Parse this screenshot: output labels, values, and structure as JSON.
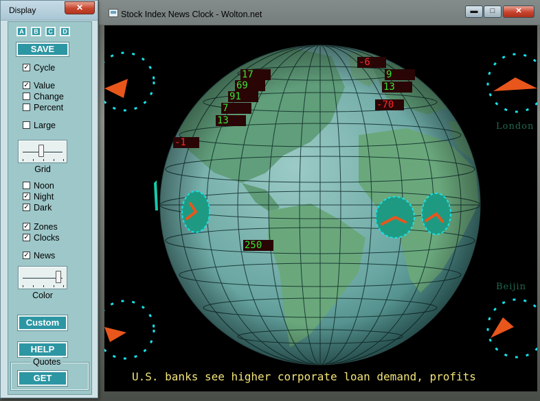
{
  "panel": {
    "title": "Display",
    "close_glyph": "✕",
    "letters": [
      "A",
      "B",
      "C",
      "D"
    ],
    "save_label": "SAVE",
    "options": [
      {
        "label": "Cycle",
        "checked": true
      },
      {
        "label": "Value",
        "checked": true
      },
      {
        "label": "Change",
        "checked": false
      },
      {
        "label": "Percent",
        "checked": false
      },
      {
        "label": "Large",
        "checked": false
      },
      {
        "label": "Noon",
        "checked": false
      },
      {
        "label": "Night",
        "checked": true
      },
      {
        "label": "Dark",
        "checked": true
      },
      {
        "label": "Zones",
        "checked": true
      },
      {
        "label": "Clocks",
        "checked": true
      },
      {
        "label": "News",
        "checked": true
      }
    ],
    "grid_label": "Grid",
    "grid_level": 0.45,
    "color_label": "Color",
    "color_level": 0.95,
    "custom_label": "Custom",
    "help_label": "HELP",
    "quotes_label": "Quotes",
    "get_label": "GET",
    "check_glyph": "✓"
  },
  "window": {
    "title": "Stock Index News Clock  -  Wolton.net",
    "minimize_glyph": "▬",
    "maximize_glyph": "□",
    "close_glyph": "✕"
  },
  "values": [
    {
      "text": "17",
      "color": "#39e639"
    },
    {
      "text": "69",
      "color": "#39e639"
    },
    {
      "text": "91",
      "color": "#39e639"
    },
    {
      "text": "7",
      "color": "#39e639"
    },
    {
      "text": "13",
      "color": "#39e639"
    },
    {
      "text": "-1",
      "color": "#ff2a2a"
    },
    {
      "text": "-6",
      "color": "#ff2a2a"
    },
    {
      "text": "9",
      "color": "#39e639"
    },
    {
      "text": "13",
      "color": "#39e639"
    },
    {
      "text": "-70",
      "color": "#ff2a2a"
    },
    {
      "text": "250",
      "color": "#39e639"
    }
  ],
  "cities": [
    "London",
    "Beijin"
  ],
  "ticker": "U.S. banks see higher corporate loan demand, profits",
  "colors": {
    "clock_face": "#1f9a82",
    "clock_ring": "#18e0e8",
    "hand": "#e8561c",
    "ocean": "#6aa6a2",
    "land": "#5e9a76"
  }
}
